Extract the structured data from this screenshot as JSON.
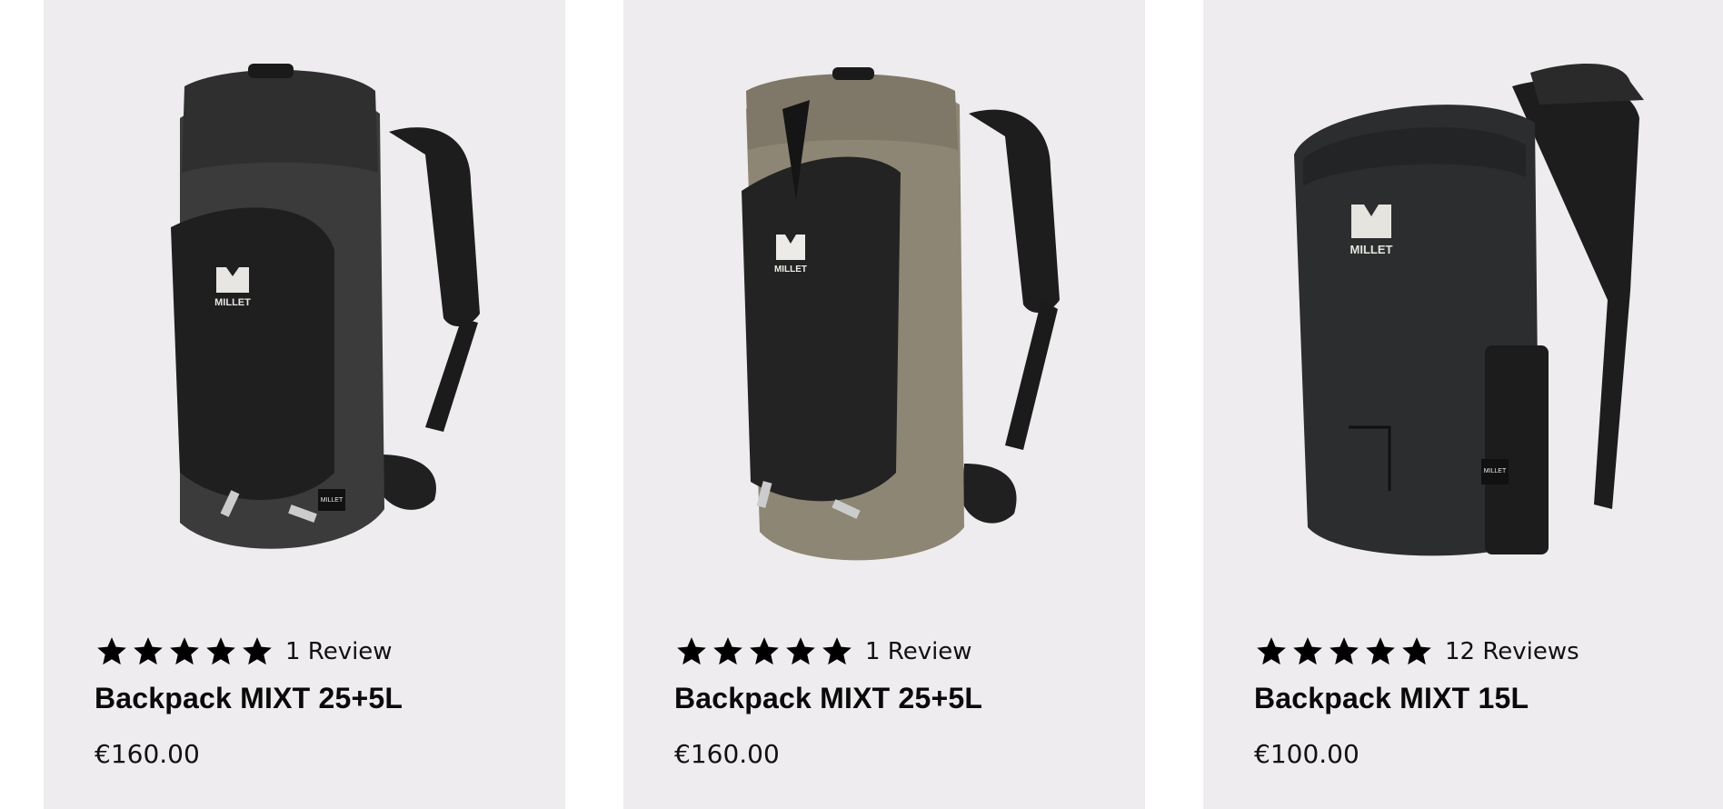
{
  "products": [
    {
      "rating_stars": 5,
      "reviews": "1 Review",
      "title": "Backpack MIXT 25+5L",
      "price": "€160.00",
      "body_color": "#3b3b3c",
      "panel_color": "#1f1f20",
      "brand_text": "MILLET",
      "tag_text": "MILLET"
    },
    {
      "rating_stars": 5,
      "reviews": "1 Review",
      "title": "Backpack MIXT 25+5L",
      "price": "€160.00",
      "body_color": "#8d8674",
      "panel_color": "#232323",
      "brand_text": "MILLET",
      "tag_text": ""
    },
    {
      "rating_stars": 5,
      "reviews": "12 Reviews",
      "title": "Backpack MIXT 15L",
      "price": "€100.00",
      "body_color": "#2c2d2f",
      "panel_color": "#2c2d2f",
      "brand_text": "MILLET",
      "tag_text": "MILLET"
    }
  ]
}
